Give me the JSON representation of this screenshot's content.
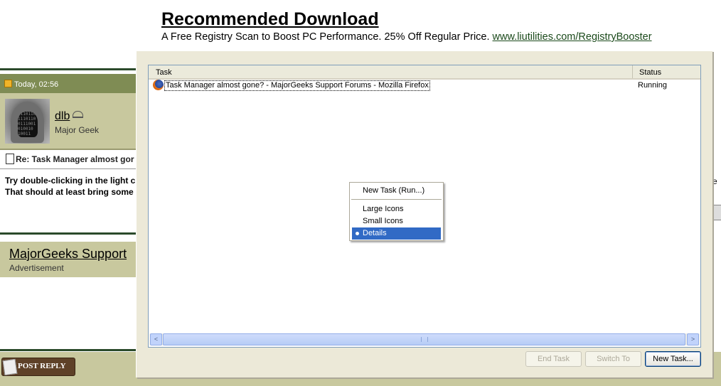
{
  "ad": {
    "title": "Recommended Download",
    "text": "A Free Registry Scan to Boost PC Performance. 25% Off Regular Price.",
    "link": "www.liutilities.com/RegistryBooster"
  },
  "post": {
    "date": "Today, 02:56",
    "username": "dlb",
    "user_title": "Major Geek",
    "title": "Re: Task Manager almost gor",
    "body_line1": "Try double-clicking in the light c",
    "body_line2": "That should at least bring some",
    "right_fragment": "e"
  },
  "forum": {
    "name": "MajorGeeks Support",
    "advertisement": "Advertisement",
    "post_reply": "POST REPLY"
  },
  "task_manager": {
    "columns": [
      "Task",
      "Status"
    ],
    "tasks": [
      {
        "name": "Task Manager almost gone? - MajorGeeks Support Forums - Mozilla Firefox",
        "status": "Running",
        "icon": "firefox-icon"
      }
    ],
    "buttons": {
      "end_task": "End Task",
      "switch_to": "Switch To",
      "new_task": "New Task..."
    },
    "scrollbar": {
      "left_arrow": "<",
      "right_arrow": ">"
    }
  },
  "context_menu": {
    "items": [
      "New Task (Run...)",
      "Large Icons",
      "Small Icons",
      "Details"
    ],
    "selected": "Details"
  },
  "colors": {
    "forum_green": "#7f8c54",
    "forum_tan": "#c8c89e",
    "menu_highlight": "#316ac5",
    "window_bg": "#ece9d8"
  }
}
